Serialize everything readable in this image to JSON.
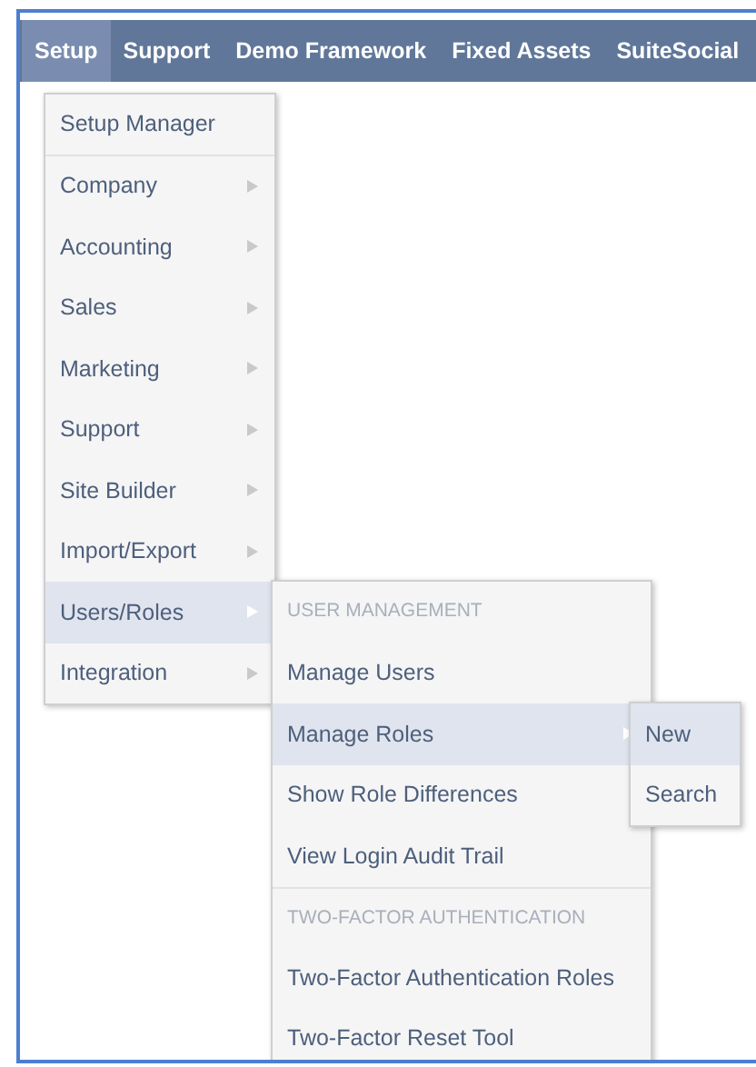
{
  "nav": [
    {
      "label": "Setup",
      "selected": true
    },
    {
      "label": "Support",
      "selected": false
    },
    {
      "label": "Demo Framework",
      "selected": false
    },
    {
      "label": "Fixed Assets",
      "selected": false
    },
    {
      "label": "SuiteSocial",
      "selected": false
    }
  ],
  "menus": [
    {
      "items": [
        {
          "kind": "link",
          "label": "Setup Manager",
          "selected": false
        },
        {
          "kind": "submenu",
          "label": "Company",
          "selected": false
        },
        {
          "kind": "submenu",
          "label": "Accounting",
          "selected": false
        },
        {
          "kind": "submenu",
          "label": "Sales",
          "selected": false
        },
        {
          "kind": "submenu",
          "label": "Marketing",
          "selected": false
        },
        {
          "kind": "submenu",
          "label": "Support",
          "selected": false
        },
        {
          "kind": "submenu",
          "label": "Site Builder",
          "selected": false
        },
        {
          "kind": "submenu",
          "label": "Import/Export",
          "selected": false
        },
        {
          "kind": "submenu",
          "label": "Users/Roles",
          "selected": true
        },
        {
          "kind": "submenu",
          "label": "Integration",
          "selected": false
        }
      ]
    },
    {
      "items": [
        {
          "kind": "heading",
          "label": "USER MANAGEMENT"
        },
        {
          "kind": "link",
          "label": "Manage Users",
          "selected": false
        },
        {
          "kind": "submenu",
          "label": "Manage Roles",
          "selected": true
        },
        {
          "kind": "link",
          "label": "Show Role Differences",
          "selected": false
        },
        {
          "kind": "link",
          "label": "View Login Audit Trail",
          "selected": false
        },
        {
          "kind": "heading",
          "label": "TWO-FACTOR AUTHENTICATION"
        },
        {
          "kind": "link",
          "label": "Two-Factor Authentication Roles",
          "selected": false
        },
        {
          "kind": "link",
          "label": "Two-Factor Reset Tool",
          "selected": false
        }
      ]
    },
    {
      "items": [
        {
          "kind": "link",
          "label": "New",
          "selected": true
        },
        {
          "kind": "link",
          "label": "Search",
          "selected": false
        }
      ]
    }
  ]
}
